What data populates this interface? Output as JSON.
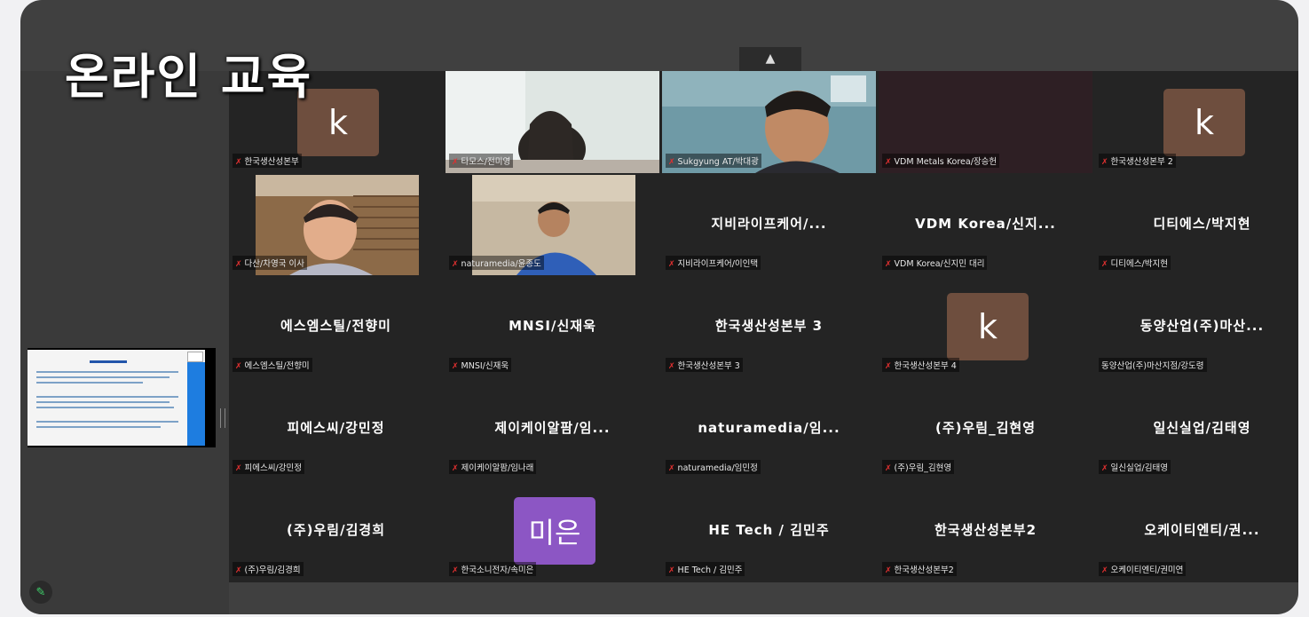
{
  "overlay_title": "온라인 교육",
  "collapse_icon": "▲",
  "tiles": [
    {
      "name": "한국생산성본부",
      "avatar": "k"
    },
    {
      "name": "타모스/전미영"
    },
    {
      "name": "Sukgyung AT/박대광"
    },
    {
      "name": "VDM Metals Korea/장승헌"
    },
    {
      "name": "한국생산성본부 2",
      "avatar": "k"
    },
    {
      "name": "다산/차영국 이사"
    },
    {
      "name": "naturamedia/윤종도"
    },
    {
      "name": "지비라이프케어/이인택",
      "big": "지비라이프케어/..."
    },
    {
      "name": "VDM Korea/신지민 대리",
      "big": "VDM Korea/신지..."
    },
    {
      "name": "디티에스/박지현",
      "big": "디티에스/박지현"
    },
    {
      "name": "에스엠스틸/전향미",
      "big": "에스엠스틸/전향미"
    },
    {
      "name": "MNSI/신재욱",
      "big": "MNSI/신재욱"
    },
    {
      "name": "한국생산성본부 3",
      "big": "한국생산성본부 3"
    },
    {
      "name": "한국생산성본부 4",
      "avatar": "k"
    },
    {
      "name": "동양산업(주)마산지점/강도령",
      "big": "동양산업(주)마산..."
    },
    {
      "name": "피에스씨/강민정",
      "big": "피에스씨/강민정"
    },
    {
      "name": "제이케이알팜/임나래",
      "big": "제이케이알팜/임..."
    },
    {
      "name": "naturamedia/임민정",
      "big": "naturamedia/임..."
    },
    {
      "name": "(주)우림_김현영",
      "big": "(주)우림_김현영"
    },
    {
      "name": "일신실업/김태영",
      "big": "일신실업/김태영"
    },
    {
      "name": "(주)우림/김경희",
      "big": "(주)우림/김경희"
    },
    {
      "name": "한국소니전자/속미은",
      "avatar": "미은"
    },
    {
      "name": "HE Tech / 김민주",
      "big": "HE Tech / 김민주"
    },
    {
      "name": "한국생산성본부2",
      "big": "한국생산성본부2"
    },
    {
      "name": "오케이티엔티/권미연",
      "big": "오케이티엔티/권..."
    }
  ],
  "mic_icon": "✗",
  "edit_icon": "✎",
  "colors": {
    "background": "#f1f1f3",
    "frame": "#404040",
    "grid": "#242424",
    "avatar_brown": "#6e4e3e",
    "avatar_purple": "#8c56c4",
    "mic_muted": "#e03030"
  }
}
